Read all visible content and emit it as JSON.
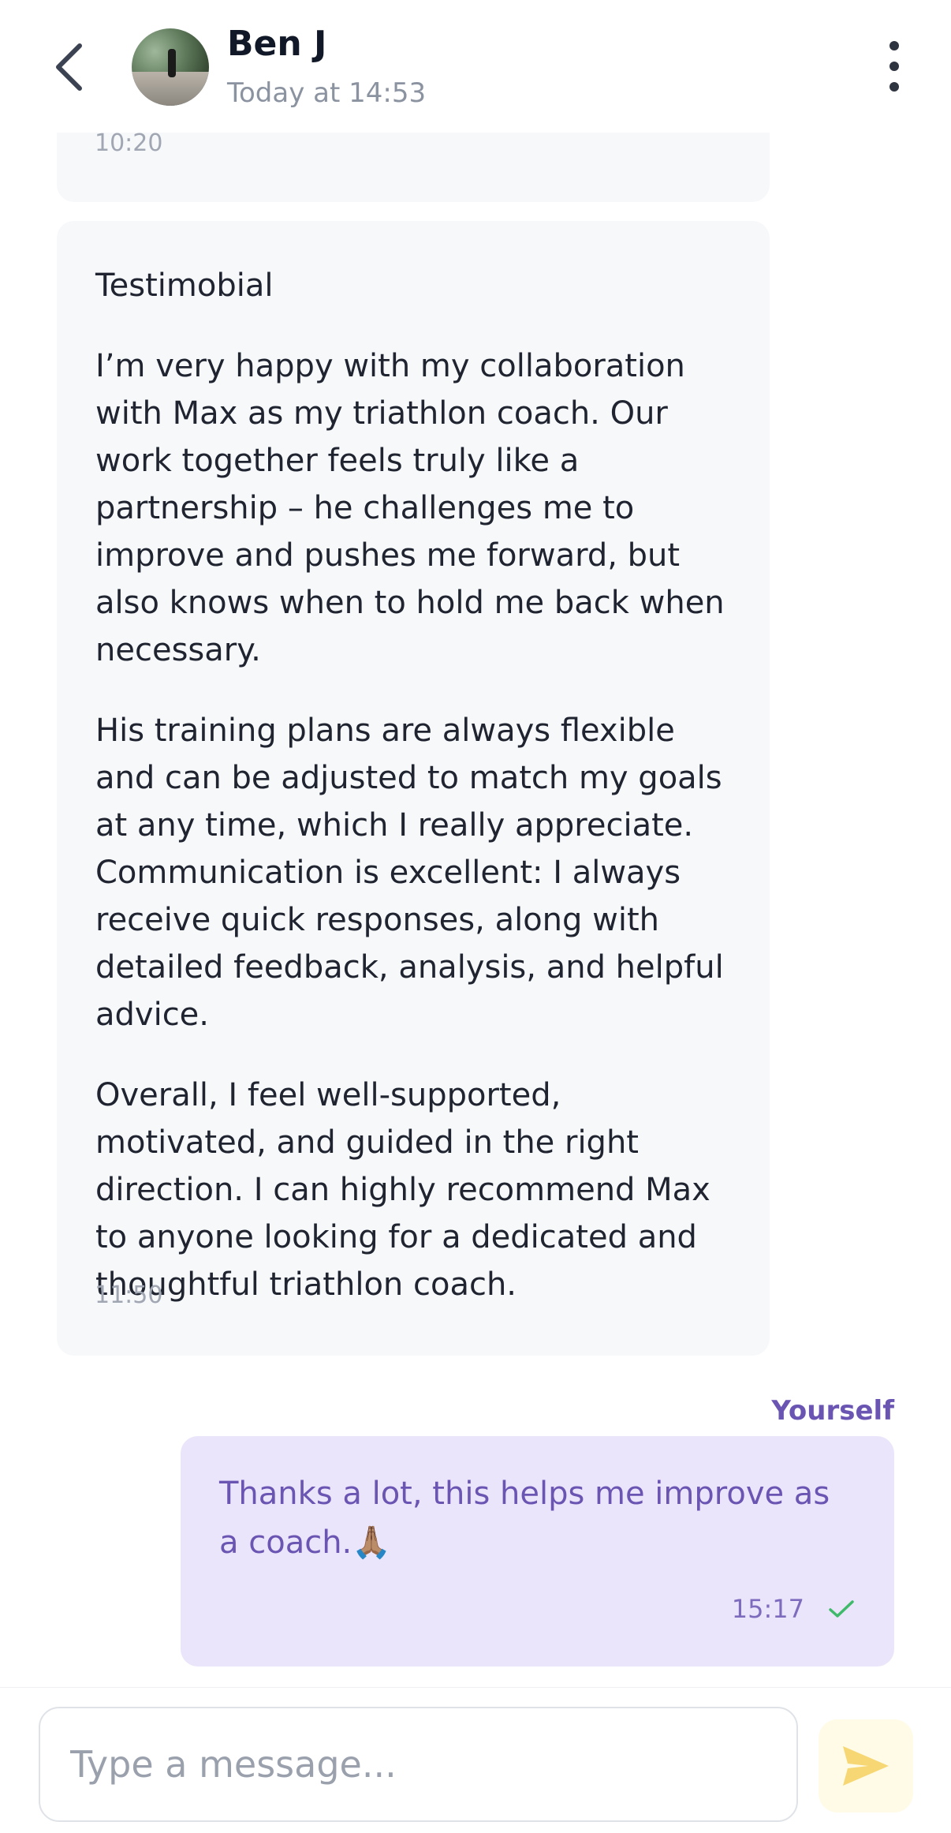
{
  "header": {
    "contact_name": "Ben J",
    "status": "Today at 14:53"
  },
  "messages": {
    "previous_time": "10:20",
    "received": {
      "title": "Testimobial",
      "paragraphs": [
        "I’m very happy with my collaboration with Max as my triathlon coach. Our work together feels truly like a partnership – he challenges me to improve and pushes me forward, but also knows when to hold me back when necessary.",
        "His training plans are always flexible and can be adjusted to match my goals at any time, which I really appreciate. Communication is excellent: I always receive quick responses, along with detailed feedback, analysis, and helpful advice.",
        "Overall, I feel well-supported, motivated, and guided in the right direction. I can highly recommend Max to anyone looking for a dedicated and thoughtful triathlon coach."
      ],
      "time": "11:50"
    },
    "sent": {
      "sender_label": "Yourself",
      "text": "Thanks a lot, this helps me improve as a coach.🙏🏽",
      "time": "15:17",
      "status_icon": "read-check-icon"
    }
  },
  "composer": {
    "placeholder": "Type a message..."
  },
  "colors": {
    "accent": "#6b55b3",
    "sent_bubble": "#ebe5fb",
    "received_bubble": "#f7f8fa",
    "check": "#3fba6a",
    "send_icon": "#f7d774"
  }
}
